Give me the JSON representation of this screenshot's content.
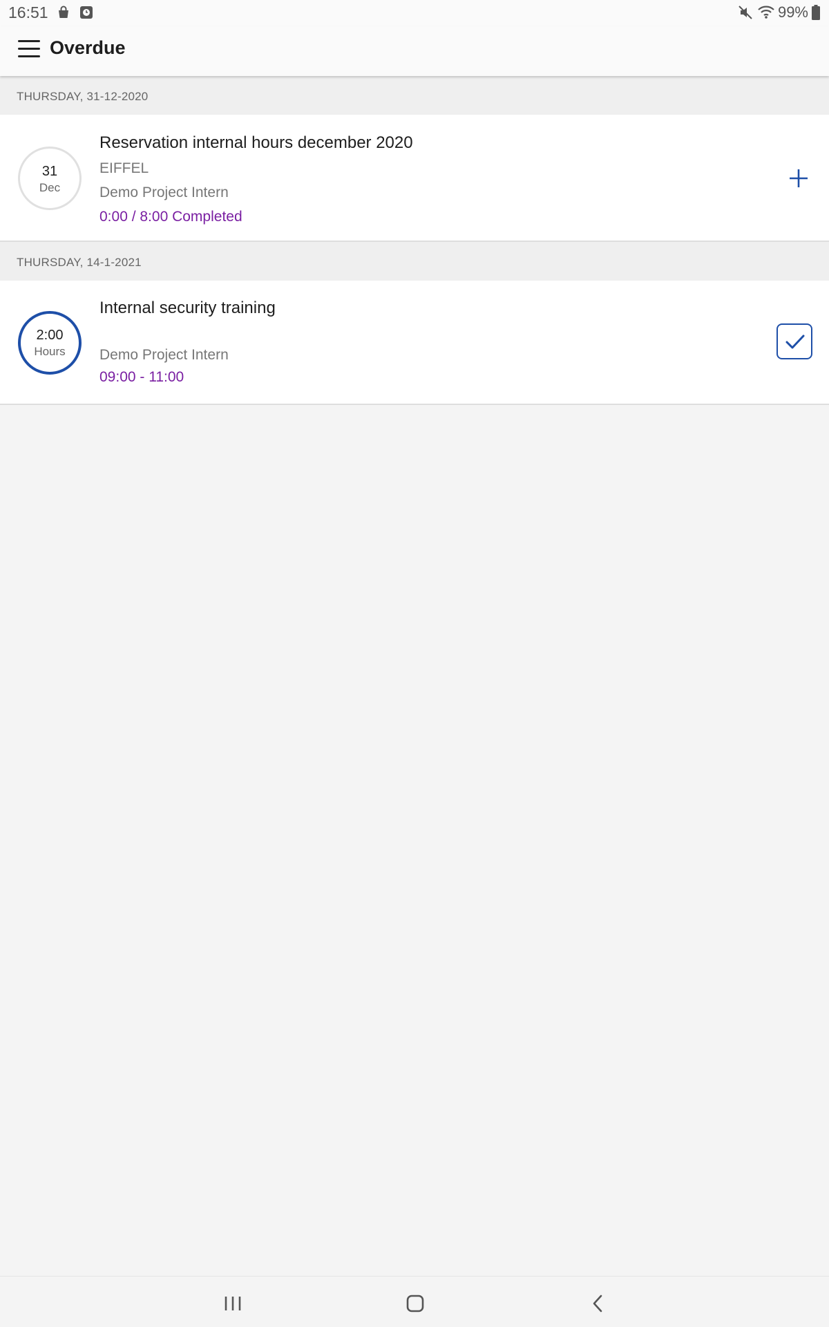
{
  "status_bar": {
    "time": "16:51",
    "battery": "99%",
    "left_icons": [
      "shopping-bag-icon",
      "clock-app-icon"
    ],
    "right_icons": [
      "mute-icon",
      "wifi-icon",
      "battery-icon"
    ]
  },
  "app_bar": {
    "title": "Overdue",
    "menu_icon": "hamburger-menu-icon"
  },
  "sections": [
    {
      "header": "THURSDAY, 31-12-2020",
      "item": {
        "circle_top": "31",
        "circle_bottom": "Dec",
        "title": "Reservation internal hours december 2020",
        "organization": "EIFFEL",
        "project": "Demo Project Intern",
        "status": "0:00 / 8:00 Completed",
        "action_icon": "plus-icon"
      }
    },
    {
      "header": "THURSDAY, 14-1-2021",
      "item": {
        "circle_top": "2:00",
        "circle_bottom": "Hours",
        "title": "Internal security training",
        "project": "Demo Project Intern",
        "time_range": "09:00 - 11:00",
        "action_icon": "checkmark-icon"
      }
    }
  ],
  "nav_bar": {
    "icons": [
      "recent-apps-icon",
      "home-icon",
      "back-icon"
    ]
  },
  "colors": {
    "accent_blue": "#1e4fa8",
    "accent_purple": "#7a1fa2",
    "background": "#f4f4f4",
    "section_header_bg": "#efefef"
  }
}
